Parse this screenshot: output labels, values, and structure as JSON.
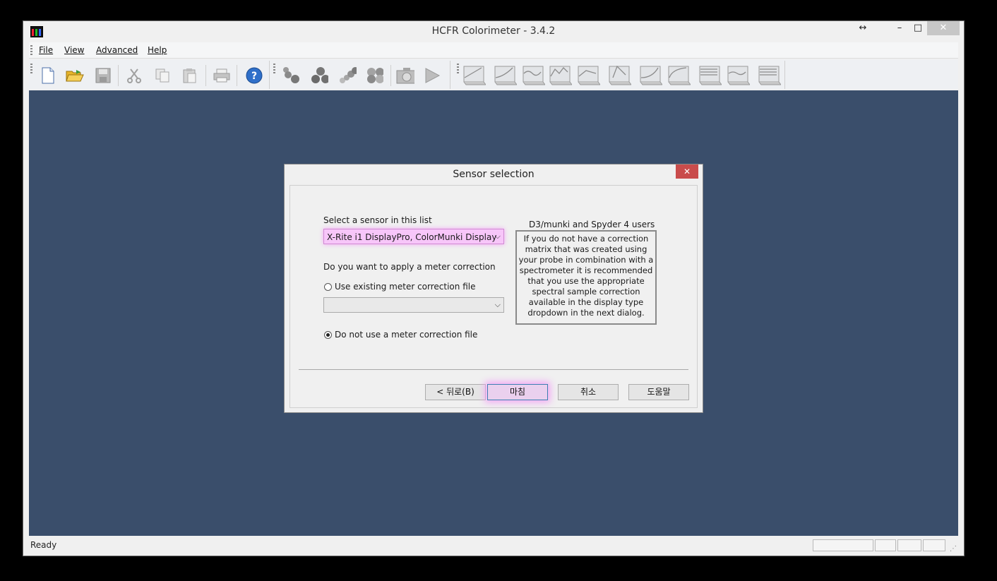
{
  "app": {
    "title": "HCFR Colorimeter - 3.4.2"
  },
  "window_controls": {
    "restore_symbol": "↔",
    "minimize_symbol": "–",
    "maximize_symbol": "□",
    "close_symbol": "✕"
  },
  "menu": {
    "items": [
      "File",
      "View",
      "Advanced",
      "Help"
    ]
  },
  "toolbar": {
    "icons": [
      "new-file-icon",
      "open-folder-icon",
      "save-icon",
      "cut-icon",
      "copy-icon",
      "paste-icon",
      "print-icon",
      "help-icon",
      "measure-grayscale-icon",
      "measure-primaries-icon",
      "measure-saturation-icon",
      "measure-all-icon",
      "camera-icon",
      "play-icon",
      "graph-1-icon",
      "graph-2-icon",
      "graph-3-icon",
      "graph-4-icon",
      "graph-5-icon",
      "graph-6-icon",
      "graph-7-icon",
      "graph-8-icon",
      "graph-9-icon",
      "graph-10-icon",
      "graph-11-icon"
    ]
  },
  "status": {
    "text": "Ready"
  },
  "dialog": {
    "title": "Sensor selection",
    "close_symbol": "✕",
    "sensor_label": "Select a sensor in this list",
    "sensor_value": "X-Rite i1 DisplayPro, ColorMunki Display",
    "correction_question": "Do you want to apply a meter correction",
    "option_existing": "Use existing meter correction file",
    "correction_file_value": "",
    "option_none": "Do not use a meter correction file",
    "info_title": "D3/munki and Spyder 4 users",
    "info_text": "If you do not have a correction matrix that was created using your probe in combination with a spectrometer it is recommended that you use the appropriate spectral sample correction available in the display type dropdown in the next dialog.",
    "buttons": {
      "back": "< 뒤로(B)",
      "finish": "마침",
      "cancel": "취소",
      "help": "도움말"
    }
  },
  "colors": {
    "client_bg": "#3a4e6b",
    "highlight": "#f7c6f9",
    "dialog_close": "#c94c4c"
  }
}
